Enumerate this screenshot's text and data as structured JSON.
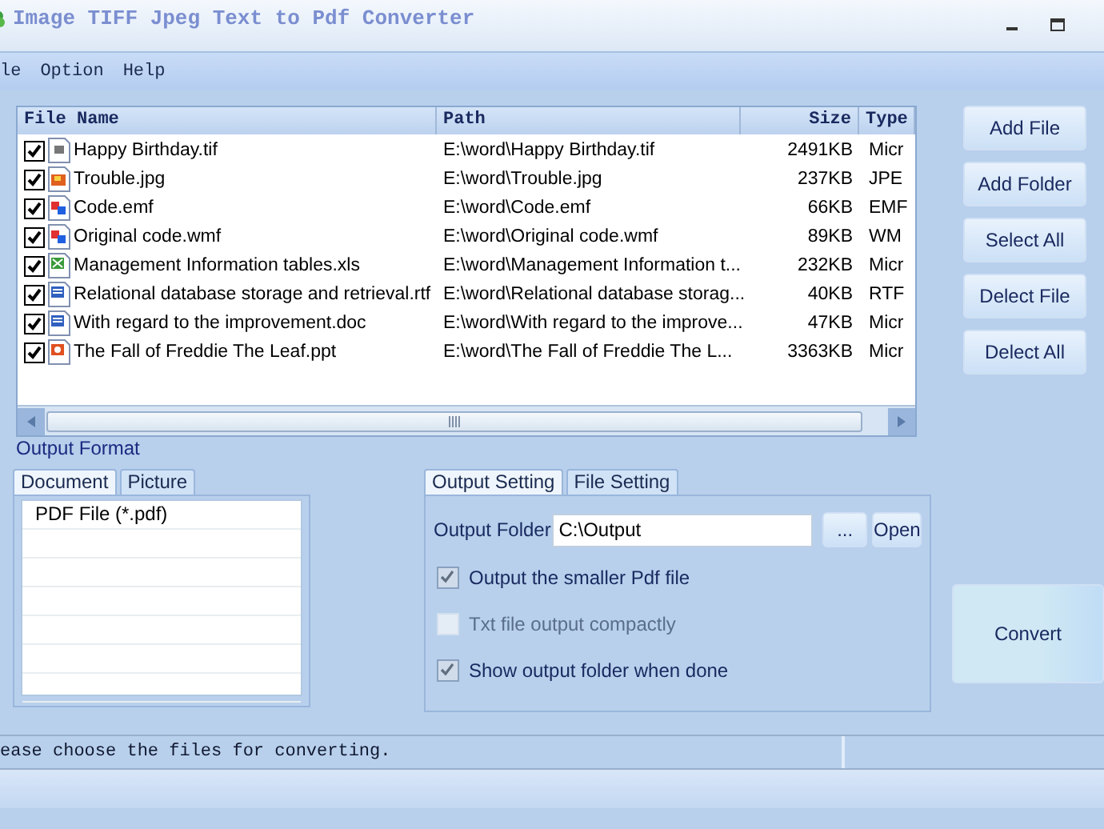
{
  "window": {
    "title": "Image TIFF Jpeg Text to Pdf Converter"
  },
  "menu": [
    "le",
    "Option",
    "Help"
  ],
  "file_list": {
    "columns": [
      "File Name",
      "Path",
      "Size",
      "Type"
    ],
    "rows": [
      {
        "checked": true,
        "kind": "tif",
        "name": "Happy Birthday.tif",
        "path": "E:\\word\\Happy Birthday.tif",
        "size": "2491KB",
        "type": "Micr"
      },
      {
        "checked": true,
        "kind": "jpg",
        "name": "Trouble.jpg",
        "path": "E:\\word\\Trouble.jpg",
        "size": "237KB",
        "type": "JPE"
      },
      {
        "checked": true,
        "kind": "metafile",
        "name": "Code.emf",
        "path": "E:\\word\\Code.emf",
        "size": "66KB",
        "type": "EMF"
      },
      {
        "checked": true,
        "kind": "metafile",
        "name": "Original code.wmf",
        "path": "E:\\word\\Original code.wmf",
        "size": "89KB",
        "type": "WM"
      },
      {
        "checked": true,
        "kind": "sheet",
        "name": "Management Information tables.xls",
        "path": "E:\\word\\Management Information t...",
        "size": "232KB",
        "type": "Micr"
      },
      {
        "checked": true,
        "kind": "doc",
        "name": "Relational database storage and retrieval.rtf",
        "path": "E:\\word\\Relational database storag...",
        "size": "40KB",
        "type": "RTF"
      },
      {
        "checked": true,
        "kind": "doc",
        "name": "With regard to the improvement.doc",
        "path": "E:\\word\\With regard to the improve...",
        "size": "47KB",
        "type": "Micr"
      },
      {
        "checked": true,
        "kind": "slides",
        "name": "The Fall of  Freddie The Leaf.ppt",
        "path": "E:\\word\\The Fall of  Freddie The L...",
        "size": "3363KB",
        "type": "Micr"
      }
    ]
  },
  "side_buttons": [
    "Add File",
    "Add Folder",
    "Select All",
    "Delect File",
    "Delect All"
  ],
  "output_format": {
    "label": "Output Format",
    "tabs": [
      {
        "label": "Document",
        "selected": true
      },
      {
        "label": "Picture",
        "selected": false
      }
    ],
    "items": [
      {
        "label": "PDF File  (*.pdf)",
        "selected": false
      }
    ]
  },
  "settings": {
    "tabs": [
      {
        "label": "Output Setting",
        "selected": true
      },
      {
        "label": "File Setting",
        "selected": false
      }
    ],
    "folder_label": "Output Folder",
    "folder_value": "C:\\Output",
    "browse_button": "...",
    "open_button": "Open",
    "options": [
      {
        "label": "Output the smaller Pdf file",
        "checked": true,
        "disabled": false
      },
      {
        "label": "Txt file output compactly",
        "checked": false,
        "disabled": true
      },
      {
        "label": "Show output folder when done",
        "checked": true,
        "disabled": false
      }
    ]
  },
  "convert_button": "Convert",
  "status_bar": {
    "message": "ease choose the files for converting."
  }
}
